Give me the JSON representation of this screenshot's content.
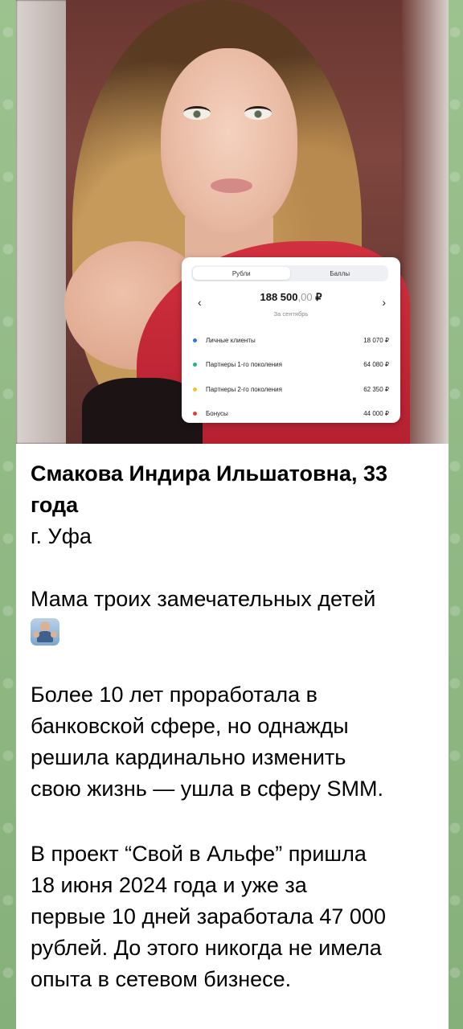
{
  "finance_card": {
    "tabs": [
      {
        "label": "Рубли",
        "active": true
      },
      {
        "label": "Баллы",
        "active": false
      }
    ],
    "amount_main": "188 500",
    "amount_decimals": ",00",
    "currency": "₽",
    "period": "За сентябрь",
    "rows": [
      {
        "label": "Личные клиенты",
        "value": "18 070 ₽",
        "color": "#2f76d6"
      },
      {
        "label": "Партнеры 1-го поколения",
        "value": "64 080 ₽",
        "color": "#29b37a"
      },
      {
        "label": "Партнеры 2-го поколения",
        "value": "62 350 ₽",
        "color": "#f2c233"
      },
      {
        "label": "Бонусы",
        "value": "44 000 ₽",
        "color": "#e23d3d"
      }
    ]
  },
  "message": {
    "name_line1": "Смакова Индира Ильшатовна, 33",
    "name_line2": "года",
    "city": "г. Уфа",
    "p1": "Мама троих замечательных детей",
    "p1_emoji": "family-emoji",
    "p2_lines": [
      "Более 10 лет проработала в",
      "банковской сфере, но однажды",
      "решила кардинально изменить",
      "свою жизнь — ушла в сферу SMM."
    ],
    "p3_lines": [
      "В проект “Свой в Альфе” пришла",
      "18 июня 2024 года и уже за",
      "первые 10 дней заработала 47 000",
      "рублей. До этого никогда не имела",
      "опыта в сетевом бизнесе."
    ]
  },
  "colors": {
    "chat_background": "#8fb784",
    "bubble_background": "#ffffff",
    "dress": "#d1303f"
  }
}
